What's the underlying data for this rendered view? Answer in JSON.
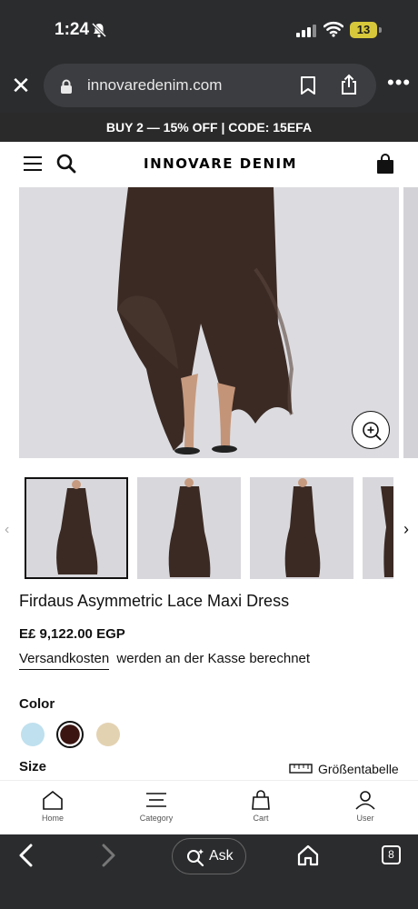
{
  "status_bar": {
    "time": "1:24",
    "battery": "13"
  },
  "browser": {
    "url": "innovaredenim.com"
  },
  "promo": {
    "text": "BUY 2 — 15% OFF | CODE: 15EFA"
  },
  "site": {
    "logo": "INNOVARE DENIM"
  },
  "product": {
    "title": "Firdaus Asymmetric Lace Maxi Dress",
    "price": "E£ 9,122.00 EGP",
    "shipping_link": "Versandkosten",
    "shipping_text": "werden an der Kasse berechnet",
    "color_label": "Color",
    "size_label": "Size",
    "size_chart": "Größentabelle",
    "colors": [
      "#bfe0ee",
      "#3a1512",
      "#e3d2b2"
    ]
  },
  "site_nav": {
    "home": "Home",
    "category": "Category",
    "cart": "Cart",
    "user": "User"
  },
  "toolbar": {
    "ask": "Ask",
    "tab_count": "8"
  }
}
